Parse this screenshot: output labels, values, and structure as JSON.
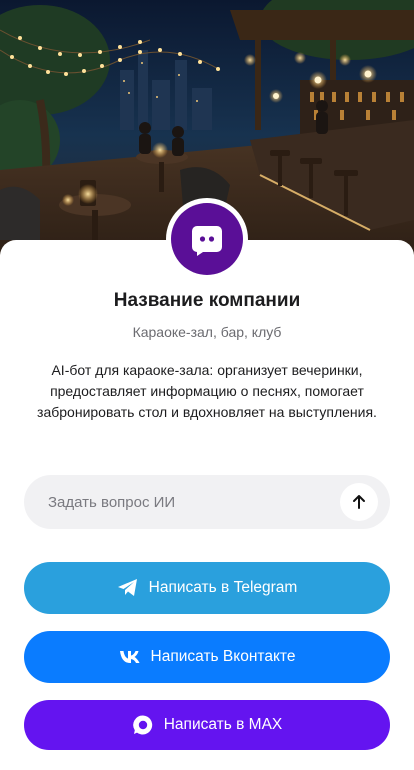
{
  "hero": {
    "image": "karaoke-bar-terrace-night"
  },
  "profile": {
    "avatar_icon": "chat-bot-icon",
    "company_name": "Название компании",
    "subtitle": "Караоке-зал, бар, клуб",
    "description": "AI-бот для караоке-зала: организует вечеринки, предоставляет информацию о песнях, помогает забронировать стол и вдохновляет на выступления."
  },
  "ask": {
    "placeholder": "Задать вопрос ИИ",
    "value": "",
    "send_icon": "arrow-up-icon"
  },
  "actions": {
    "telegram": {
      "label": "Написать в Telegram",
      "icon": "telegram-icon",
      "color": "#2aa0dd"
    },
    "vk": {
      "label": "Написать Вконтакте",
      "icon": "vk-icon",
      "color": "#0a7cff"
    },
    "max": {
      "label": "Написать в MAX",
      "icon": "max-icon",
      "color": "#6414f0"
    }
  },
  "colors": {
    "avatar_bg": "#5a0f97"
  }
}
